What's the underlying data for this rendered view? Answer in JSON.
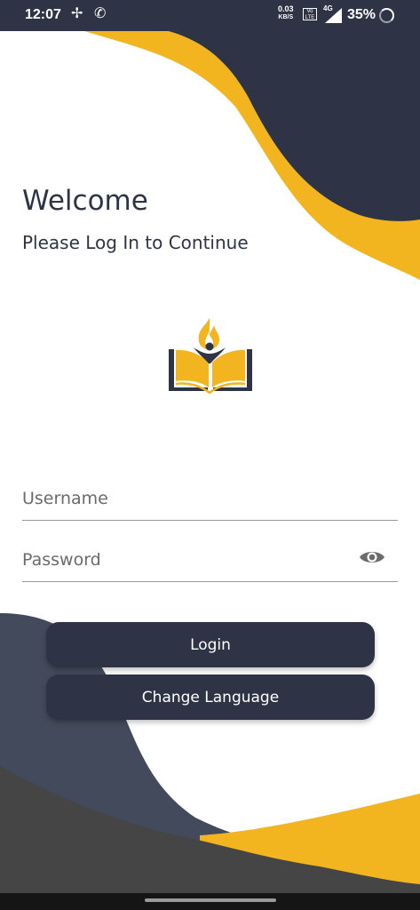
{
  "status_bar": {
    "time": "12:07",
    "net_speed_value": "0.03",
    "net_speed_unit": "KB/S",
    "volte": "Vo\nLTE",
    "network": "4G",
    "battery": "35%"
  },
  "login": {
    "welcome": "Welcome",
    "subtitle": "Please Log In to Continue",
    "username_placeholder": "Username",
    "password_placeholder": "Password",
    "login_label": "Login",
    "language_label": "Change Language"
  },
  "colors": {
    "navy": "#2e3445",
    "gold": "#f3b51f",
    "slate": "#434a5b",
    "dark_gray": "#454545"
  },
  "icons": [
    "fan-icon",
    "wifi-call-icon",
    "signal-icon",
    "battery-icon",
    "eye-icon",
    "book-logo-icon"
  ]
}
